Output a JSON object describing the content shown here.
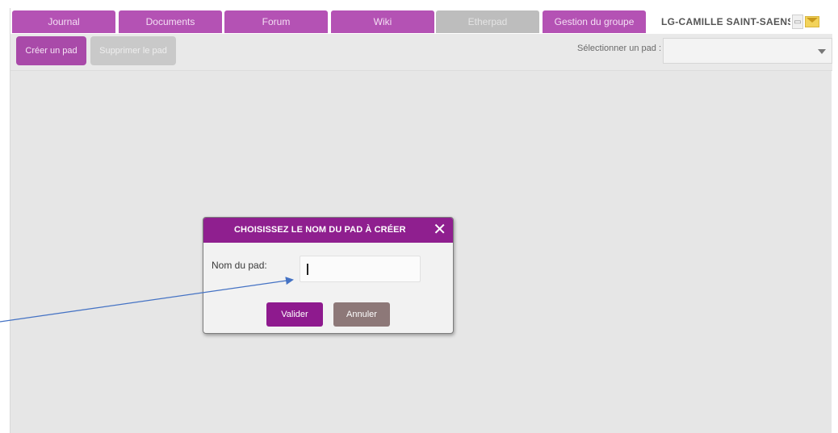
{
  "tabs": [
    {
      "label": "Journal",
      "state": "active"
    },
    {
      "label": "Documents",
      "state": "active"
    },
    {
      "label": "Forum",
      "state": "active"
    },
    {
      "label": "Wiki",
      "state": "active"
    },
    {
      "label": "Etherpad",
      "state": "disabled"
    },
    {
      "label": "Gestion du groupe",
      "state": "active"
    }
  ],
  "header": {
    "group_name": "LG-CAMILLE SAINT-SAENS",
    "icons": [
      "printer-icon",
      "mail-icon"
    ]
  },
  "toolbar": {
    "create_label": "Créer un pad",
    "delete_label": "Supprimer le pad",
    "select_label": "Sélectionner un pad :",
    "select_value": ""
  },
  "dialog": {
    "title": "CHOISISSEZ LE NOM DU PAD À CRÉER",
    "close_icon": "close-icon",
    "field_label": "Nom du pad:",
    "field_value": "",
    "confirm_label": "Valider",
    "cancel_label": "Annuler"
  },
  "colors": {
    "tab": "#b452b4",
    "tab_disabled": "#bdbdbd",
    "dialog_header": "#8f1f8f",
    "confirm_button": "#8e1a8e",
    "cancel_button": "#8d7878",
    "annotation_arrow": "#4472c4"
  }
}
